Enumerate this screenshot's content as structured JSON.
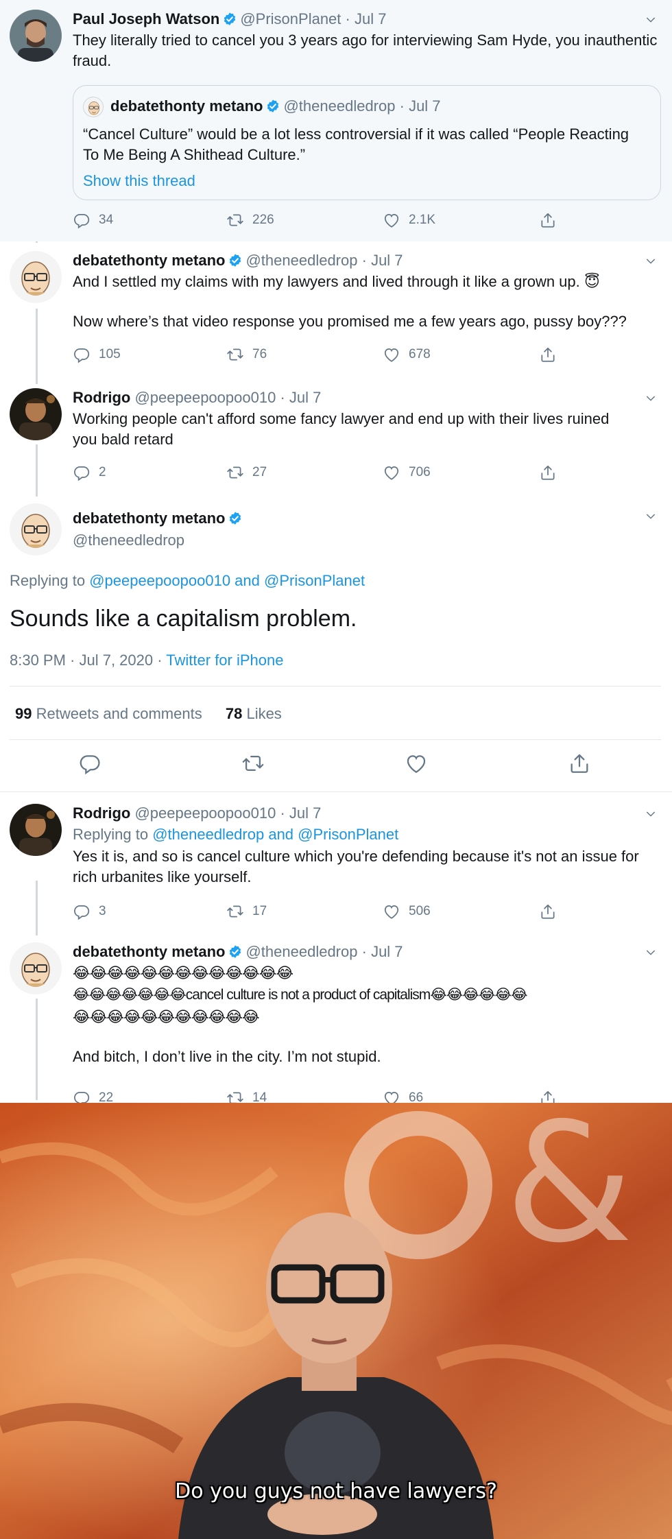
{
  "colors": {
    "link": "#1b95e0",
    "muted": "#657786",
    "verified": "#1da1f2"
  },
  "tweets": [
    {
      "name": "Paul Joseph Watson",
      "handle": "@PrisonPlanet",
      "time": "Jul 7",
      "avatar_icon": "man-avatar-photo",
      "text": "They literally tried to cancel you 3 years ago for interviewing Sam Hyde, you inauthentic fraud.",
      "quote": {
        "name": "debatethonty metano",
        "handle": "@theneedledrop",
        "time": "Jul 7",
        "text": "“Cancel Culture” would be a lot less controversial if it was called “People Reacting To Me Being A Shithead Culture.”",
        "show_thread": "Show this thread"
      },
      "replies": "34",
      "retweets": "226",
      "likes": "2.1K"
    },
    {
      "name": "debatethonty metano",
      "handle": "@theneedledrop",
      "time": "Jul 7",
      "avatar_icon": "bald-glasses-cartoon-avatar",
      "text1": "And I settled my claims with my lawyers and lived through it like a grown up. 😇",
      "text2": "Now where’s that video response you promised me a few years ago, pussy boy???",
      "replies": "105",
      "retweets": "76",
      "likes": "678"
    },
    {
      "name": "Rodrigo",
      "handle": "@peepeepoopoo010",
      "time": "Jul 7",
      "avatar_icon": "rodrigo-avatar-photo",
      "text": "Working people can't afford some fancy lawyer and end up with their lives ruined you bald retard",
      "replies": "2",
      "retweets": "27",
      "likes": "706"
    }
  ],
  "main": {
    "name": "debatethonty metano",
    "handle": "@theneedledrop",
    "replying_prefix": "Replying to",
    "replying_to": "@peepeepoopoo010 and @PrisonPlanet",
    "text": "Sounds like a capitalism problem.",
    "timestamp": "8:30 PM · Jul 7, 2020",
    "dot": "·",
    "source": "Twitter for iPhone",
    "retweets_count": "99",
    "retweets_label": "Retweets and comments",
    "likes_count": "78",
    "likes_label": "Likes"
  },
  "replies": [
    {
      "name": "Rodrigo",
      "handle": "@peepeepoopoo010",
      "time": "Jul 7",
      "replying_prefix": "Replying to",
      "replying_to": "@theneedledrop and @PrisonPlanet",
      "text": "Yes it is, and so is cancel culture which you're defending because it's not an issue for rich urbanites like yourself.",
      "replies": "3",
      "retweets": "17",
      "likes": "506"
    },
    {
      "name": "debatethonty metano",
      "handle": "@theneedledrop",
      "time": "Jul 7",
      "text1": "😂😂😂😂😂😂😂😂😂😂😂😂😂",
      "text2": "😂😂😂😂😂😂😂cancel culture is not a product of capitalism😂😂😂😂😂😂",
      "text3": "😂😂😂😂😂😂😂😂😂😂😂",
      "text4": "And bitch, I don’t live in the city. I’m not stupid.",
      "replies": "22",
      "retweets": "14",
      "likes": "66"
    }
  ],
  "meme": {
    "caption": "Do you guys not have lawyers?",
    "text_logo": "&"
  }
}
